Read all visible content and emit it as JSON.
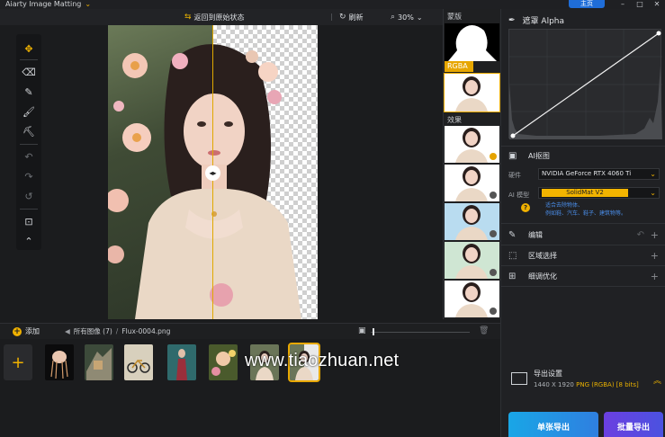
{
  "app": {
    "title": "Aiarty Image Matting",
    "home_label": "主页"
  },
  "topbar": {
    "back_label": "返回到原始状态",
    "refresh_label": "刷新",
    "zoom_value": "30%",
    "mask_label": "蒙版"
  },
  "preview": {
    "rgba_label": "RGBA",
    "effects_label": "效果",
    "effects": [
      "",
      "",
      "",
      "",
      ""
    ]
  },
  "right_panel": {
    "alpha_title": "遮罩 Alpha",
    "ai_title": "AI抠图",
    "hardware_label": "硬件",
    "hardware_value": "NVIDIA GeForce RTX 4060 Ti",
    "model_label": "AI 模型",
    "model_value": "SolidMat  V2",
    "model_hint_1": "适合去除物体、",
    "model_hint_2": "例如鞋、汽车、鞋子、建筑物等。",
    "edit_label": "编辑",
    "region_label": "区域选择",
    "refine_label": "细调优化",
    "export_settings_title": "导出设置",
    "export_dims": "1440 X 1920",
    "export_format": "PNG (RGBA) [8 bits]",
    "single_export": "单张导出",
    "batch_export": "批量导出"
  },
  "bottom": {
    "add_label": "添加",
    "all_images": "所有图像 (7)",
    "file_name": "Flux-0004.png",
    "zoom_fraction": 0.02
  },
  "watermark": "www.tiaozhuan.net",
  "colors": {
    "accent": "#f0b100",
    "export_single": "#1aa3e0",
    "export_batch": "#5b46d9"
  }
}
